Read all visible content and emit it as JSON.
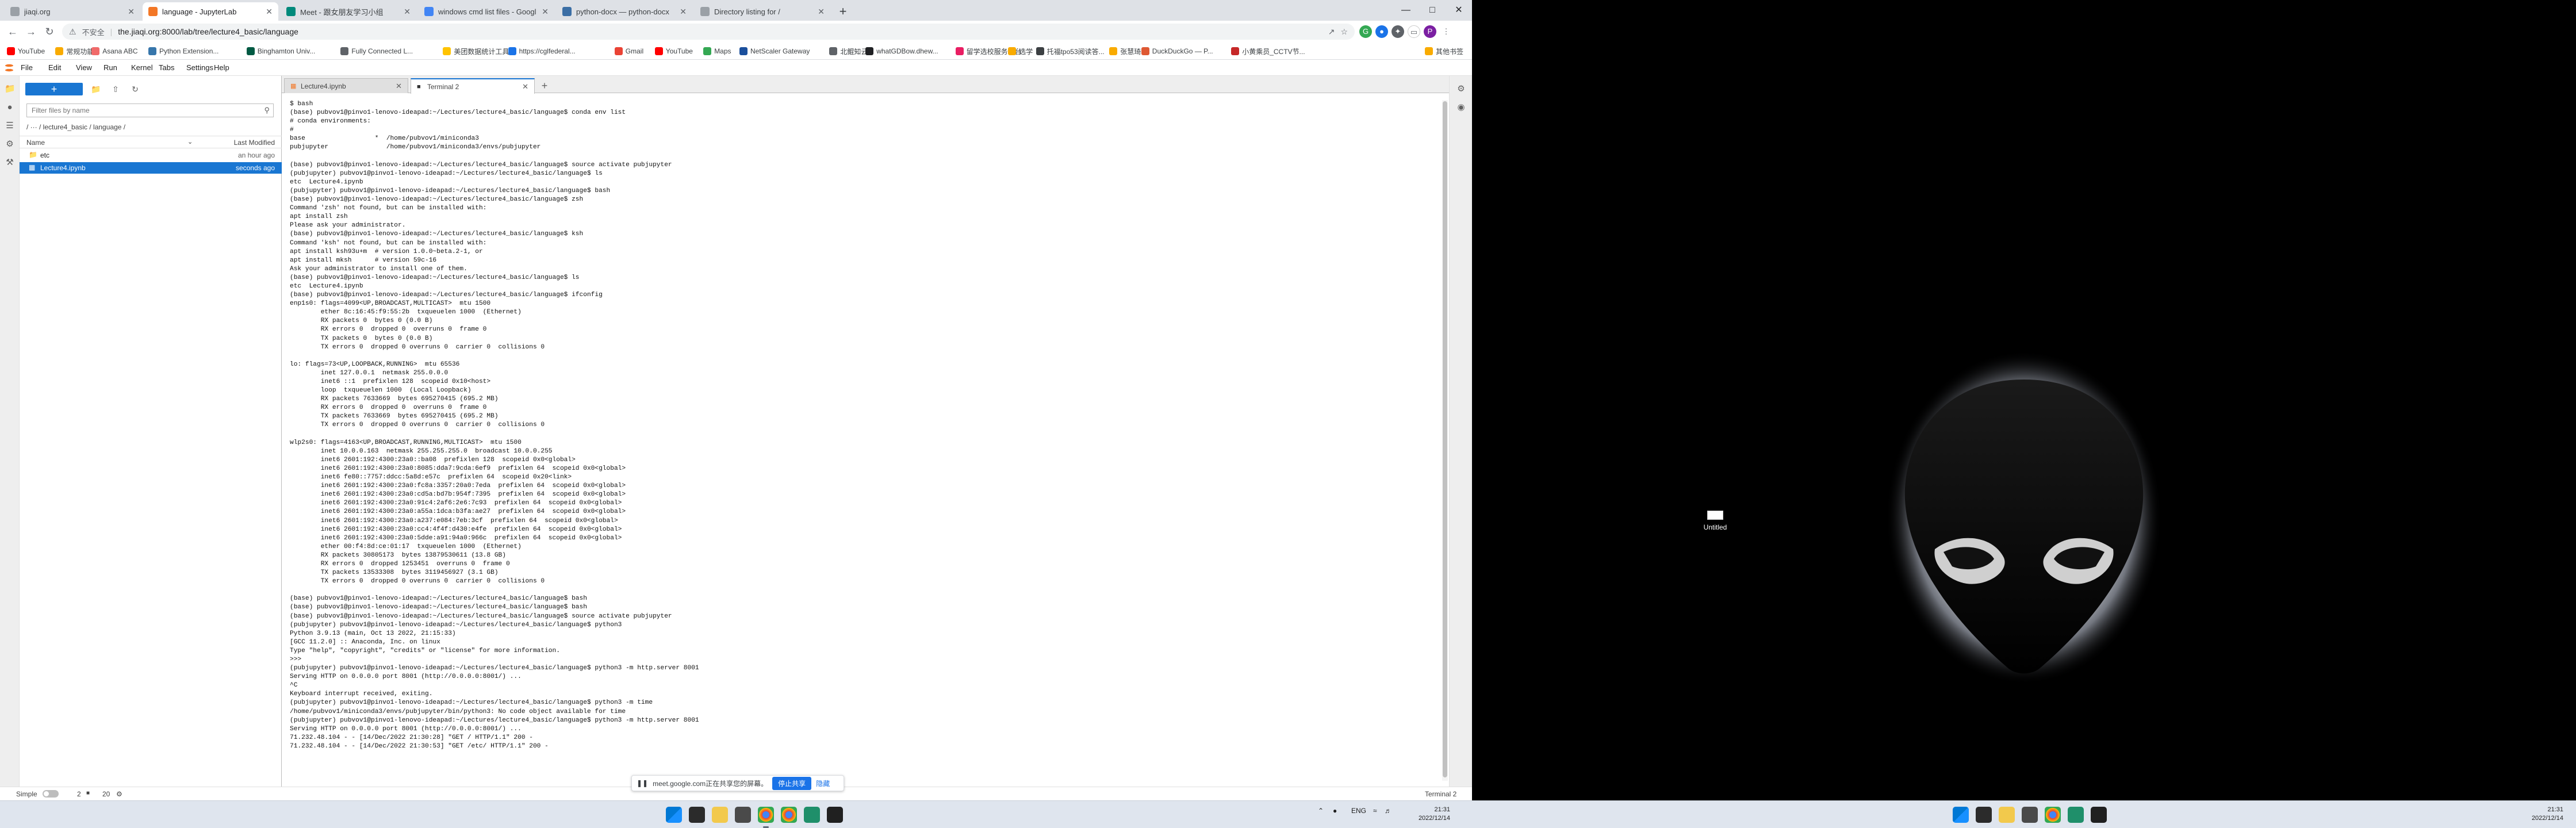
{
  "colors": {
    "accent": "#1976d2",
    "chrome_accent": "#1a73e8",
    "share_stop": "#1a73e8"
  },
  "browser": {
    "tabs": [
      {
        "label": "jiaqi.org",
        "icon": "globe-icon",
        "color": "#9aa0a6",
        "active": false
      },
      {
        "label": "language - JupyterLab",
        "icon": "jupyter-icon",
        "color": "#f37726",
        "active": true
      },
      {
        "label": "Meet - 跟女朋友学习小组",
        "icon": "meet-icon",
        "color": "#00897b",
        "active": false
      },
      {
        "label": "windows cmd list files - Googl",
        "icon": "google-icon",
        "color": "#4285f4",
        "active": false
      },
      {
        "label": "python-docx — python-docx",
        "icon": "docs-icon",
        "color": "#3b6ea5",
        "active": false
      },
      {
        "label": "Directory listing for /",
        "icon": "globe-icon",
        "color": "#9aa0a6",
        "active": false
      }
    ],
    "new_tab": "+",
    "insecure_label": "不安全",
    "url": "the.jiaqi.org:8000/lab/tree/lecture4_basic/language",
    "bookmarks": [
      {
        "label": "YouTube",
        "color": "#ff0000"
      },
      {
        "label": "常规功能",
        "color": "#f9ab00"
      },
      {
        "label": "Asana ABC",
        "color": "#f06a6a"
      },
      {
        "label": "Python Extension...",
        "color": "#3776ab"
      },
      {
        "label": "Binghamton Univ...",
        "color": "#005a43"
      },
      {
        "label": "Fully Connected L...",
        "color": "#5f6368"
      },
      {
        "label": "美团数据统计工具...",
        "color": "#ffc300"
      },
      {
        "label": "https://cglfederal...",
        "color": "#1a73e8"
      },
      {
        "label": "Gmail",
        "color": "#ea4335"
      },
      {
        "label": "YouTube",
        "color": "#ff0000"
      },
      {
        "label": "Maps",
        "color": "#34a853"
      },
      {
        "label": "NetScaler Gateway",
        "color": "#1b4f9c"
      },
      {
        "label": "北鲲知云",
        "color": "#5f6368"
      },
      {
        "label": "whatGDBow.dhew...",
        "color": "#202124"
      },
      {
        "label": "留学选校服务平台",
        "color": "#e91e63"
      },
      {
        "label": "选学",
        "color": "#f9ab00"
      },
      {
        "label": "托福tpo53阅读答...",
        "color": "#3c4043"
      },
      {
        "label": "张慧琦",
        "color": "#f9ab00"
      },
      {
        "label": "DuckDuckGo — P...",
        "color": "#de5833"
      },
      {
        "label": "小黄乘员_CCTV节...",
        "color": "#c62828"
      }
    ],
    "other_bookmarks": "其他书签"
  },
  "jupyter": {
    "menu": [
      "File",
      "Edit",
      "View",
      "Run",
      "Kernel",
      "Tabs",
      "Settings",
      "Help"
    ],
    "filebrowser": {
      "new_label": "+",
      "filter_placeholder": "Filter files by name",
      "breadcrumbs": "/ ··· / lecture4_basic / language /",
      "col_name": "Name",
      "col_modified": "Last Modified",
      "files": [
        {
          "name": "etc",
          "type": "folder",
          "modified": "an hour ago",
          "selected": false
        },
        {
          "name": "Lecture4.ipynb",
          "type": "notebook",
          "modified": "seconds ago",
          "selected": true
        }
      ]
    },
    "tabs": [
      {
        "label": "Lecture4.ipynb",
        "icon": "notebook-icon",
        "active": false
      },
      {
        "label": "Terminal 2",
        "icon": "terminal-icon",
        "active": true
      }
    ],
    "terminal_lines": [
      "$ bash",
      "(base) pubvov1@pinvo1-lenovo-ideapad:~/Lectures/lecture4_basic/language$ conda env list",
      "# conda environments:",
      "#",
      "base                  *  /home/pubvov1/miniconda3",
      "pubjupyter               /home/pubvov1/miniconda3/envs/pubjupyter",
      "",
      "(base) pubvov1@pinvo1-lenovo-ideapad:~/Lectures/lecture4_basic/language$ source activate pubjupyter",
      "(pubjupyter) pubvov1@pinvo1-lenovo-ideapad:~/Lectures/lecture4_basic/language$ ls",
      "etc  Lecture4.ipynb",
      "(pubjupyter) pubvov1@pinvo1-lenovo-ideapad:~/Lectures/lecture4_basic/language$ bash",
      "(base) pubvov1@pinvo1-lenovo-ideapad:~/Lectures/lecture4_basic/language$ zsh",
      "Command 'zsh' not found, but can be installed with:",
      "apt install zsh",
      "Please ask your administrator.",
      "(base) pubvov1@pinvo1-lenovo-ideapad:~/Lectures/lecture4_basic/language$ ksh",
      "Command 'ksh' not found, but can be installed with:",
      "apt install ksh93u+m  # version 1.0.0~beta.2-1, or",
      "apt install mksh      # version 59c-16",
      "Ask your administrator to install one of them.",
      "(base) pubvov1@pinvo1-lenovo-ideapad:~/Lectures/lecture4_basic/language$ ls",
      "etc  Lecture4.ipynb",
      "(base) pubvov1@pinvo1-lenovo-ideapad:~/Lectures/lecture4_basic/language$ ifconfig",
      "enp1s0: flags=4099<UP,BROADCAST,MULTICAST>  mtu 1500",
      "        ether 8c:16:45:f9:55:2b  txqueuelen 1000  (Ethernet)",
      "        RX packets 0  bytes 0 (0.0 B)",
      "        RX errors 0  dropped 0  overruns 0  frame 0",
      "        TX packets 0  bytes 0 (0.0 B)",
      "        TX errors 0  dropped 0 overruns 0  carrier 0  collisions 0",
      "",
      "lo: flags=73<UP,LOOPBACK,RUNNING>  mtu 65536",
      "        inet 127.0.0.1  netmask 255.0.0.0",
      "        inet6 ::1  prefixlen 128  scopeid 0x10<host>",
      "        loop  txqueuelen 1000  (Local Loopback)",
      "        RX packets 7633669  bytes 695270415 (695.2 MB)",
      "        RX errors 0  dropped 0  overruns 0  frame 0",
      "        TX packets 7633669  bytes 695270415 (695.2 MB)",
      "        TX errors 0  dropped 0 overruns 0  carrier 0  collisions 0",
      "",
      "wlp2s0: flags=4163<UP,BROADCAST,RUNNING,MULTICAST>  mtu 1500",
      "        inet 10.0.0.163  netmask 255.255.255.0  broadcast 10.0.0.255",
      "        inet6 2601:192:4300:23a0::ba08  prefixlen 128  scopeid 0x0<global>",
      "        inet6 2601:192:4300:23a0:8085:dda7:9cda:6ef9  prefixlen 64  scopeid 0x0<global>",
      "        inet6 fe80::7757:ddcc:5a8d:e57c  prefixlen 64  scopeid 0x20<link>",
      "        inet6 2601:192:4300:23a0:fc8a:3357:20a0:7eda  prefixlen 64  scopeid 0x0<global>",
      "        inet6 2601:192:4300:23a0:cd5a:bd7b:954f:7395  prefixlen 64  scopeid 0x0<global>",
      "        inet6 2601:192:4300:23a0:91c4:2af6:2e6:7c93  prefixlen 64  scopeid 0x0<global>",
      "        inet6 2601:192:4300:23a0:a55a:1dca:b3fa:ae27  prefixlen 64  scopeid 0x0<global>",
      "        inet6 2601:192:4300:23a0:a237:e084:7eb:3cf  prefixlen 64  scopeid 0x0<global>",
      "        inet6 2601:192:4300:23a0:cc4:4f4f:d430:e4fe  prefixlen 64  scopeid 0x0<global>",
      "        inet6 2601:192:4300:23a0:5dde:a91:94a0:966c  prefixlen 64  scopeid 0x0<global>",
      "        ether 00:f4:8d:ce:01:17  txqueuelen 1000  (Ethernet)",
      "        RX packets 30805173  bytes 13879530611 (13.8 GB)",
      "        RX errors 0  dropped 1253451  overruns 0  frame 0",
      "        TX packets 13533308  bytes 3119456927 (3.1 GB)",
      "        TX errors 0  dropped 0 overruns 0  carrier 0  collisions 0",
      "",
      "(base) pubvov1@pinvo1-lenovo-ideapad:~/Lectures/lecture4_basic/language$ bash",
      "(base) pubvov1@pinvo1-lenovo-ideapad:~/Lectures/lecture4_basic/language$ bash",
      "(base) pubvov1@pinvo1-lenovo-ideapad:~/Lectures/lecture4_basic/language$ source activate pubjupyter",
      "(pubjupyter) pubvov1@pinvo1-lenovo-ideapad:~/Lectures/lecture4_basic/language$ python3",
      "Python 3.9.13 (main, Oct 13 2022, 21:15:33)",
      "[GCC 11.2.0] :: Anaconda, Inc. on linux",
      "Type \"help\", \"copyright\", \"credits\" or \"license\" for more information.",
      ">>>",
      "(pubjupyter) pubvov1@pinvo1-lenovo-ideapad:~/Lectures/lecture4_basic/language$ python3 -m http.server 8001",
      "Serving HTTP on 0.0.0.0 port 8001 (http://0.0.0.0:8001/) ...",
      "^C",
      "Keyboard interrupt received, exiting.",
      "(pubjupyter) pubvov1@pinvo1-lenovo-ideapad:~/Lectures/lecture4_basic/language$ python3 -m time",
      "/home/pubvov1/miniconda3/envs/pubjupyter/bin/python3: No code object available for time",
      "(pubjupyter) pubvov1@pinvo1-lenovo-ideapad:~/Lectures/lecture4_basic/language$ python3 -m http.server 8001",
      "Serving HTTP on 0.0.0.0 port 8001 (http://0.0.0.0:8001/) ...",
      "71.232.48.104 - - [14/Dec/2022 21:30:28] \"GET / HTTP/1.1\" 200 -",
      "71.232.48.104 - - [14/Dec/2022 21:30:53] \"GET /etc/ HTTP/1.1\" 200 -"
    ],
    "status": {
      "mode": "Simple",
      "count_a": "2",
      "count_b": "20",
      "right": "Terminal 2"
    }
  },
  "share_bar": {
    "text": "meet.google.com正在共享您的屏幕。",
    "stop": "停止共享",
    "hide": "隐藏"
  },
  "taskbar_left": {
    "tray": "ENG",
    "time": "21:31",
    "date": "2022/12/14"
  },
  "taskbar_right": {
    "time": "21:31",
    "date": "2022/12/14"
  },
  "desktop": {
    "icon_label": "Untitled"
  }
}
